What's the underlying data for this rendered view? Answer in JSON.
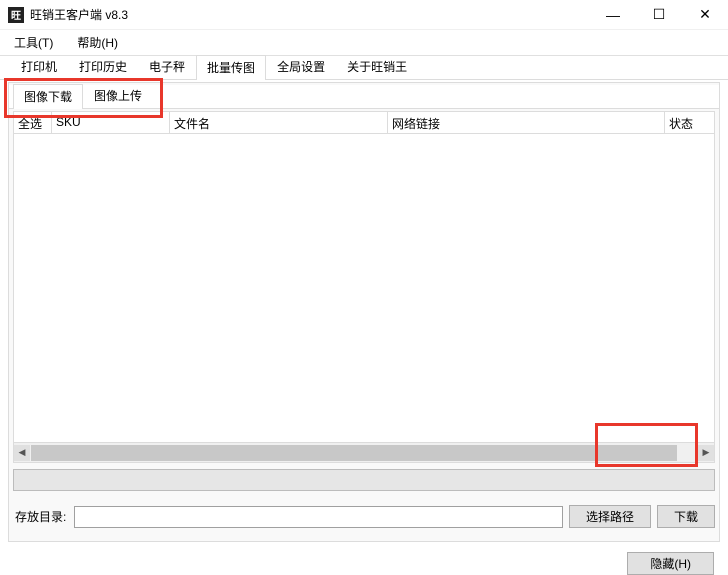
{
  "window": {
    "title": "旺销王客户端 v8.3",
    "app_icon_text": "旺"
  },
  "menu": {
    "tools": "工具(T)",
    "help": "帮助(H)"
  },
  "tabs": {
    "printer": "打印机",
    "print_history": "打印历史",
    "scale": "电子秤",
    "batch_image": "批量传图",
    "global_settings": "全局设置",
    "about": "关于旺销王"
  },
  "subtabs": {
    "image_download": "图像下载",
    "image_upload": "图像上传"
  },
  "columns": {
    "select_all": "全选",
    "sku": "SKU",
    "file_name": "文件名",
    "network_link": "网络链接",
    "status": "状态"
  },
  "controls": {
    "save_dir_label": "存放目录:",
    "save_dir_value": "",
    "choose_path": "选择路径",
    "download": "下载",
    "hide": "隐藏(H)"
  },
  "win": {
    "min": "—",
    "max": "☐",
    "close": "✕"
  },
  "scroll": {
    "left": "◀",
    "right": "▶"
  }
}
